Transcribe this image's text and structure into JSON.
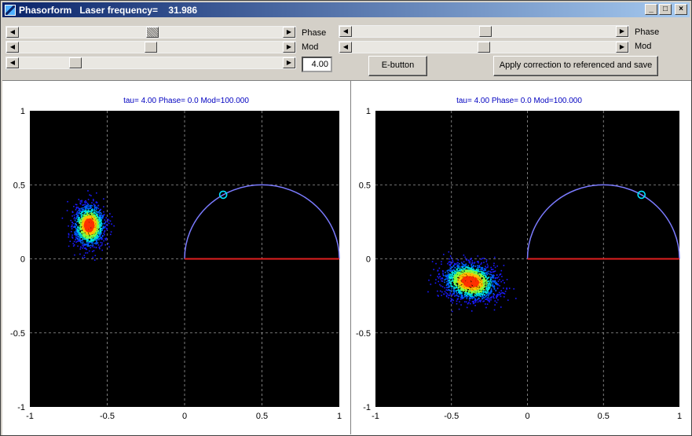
{
  "window": {
    "title": "Phasorform   Laser frequency=    31.986",
    "min_label": "_",
    "max_label": "□",
    "close_label": "×"
  },
  "controls": {
    "left": {
      "phase_label": "Phase",
      "mod_label": "Mod",
      "tau_value": "4.00"
    },
    "right": {
      "phase_label": "Phase",
      "mod_label": "Mod"
    },
    "e_button_label": "E-button",
    "apply_button_label": "Apply correction to referenced and save"
  },
  "plots": [
    {
      "title": "tau= 4.00 Phase=  0.0 Mod=100.000",
      "x_ticks": [
        "-1",
        "-0.5",
        "0",
        "0.5",
        "1"
      ],
      "y_ticks": [
        "1",
        "0.5",
        "0",
        "-0.5",
        "-1"
      ]
    },
    {
      "title": "tau= 4.00 Phase=  0.0 Mod=100.000",
      "x_ticks": [
        "-1",
        "-0.5",
        "0",
        "0.5",
        "1"
      ],
      "y_ticks": [
        "1",
        "0.5",
        "0",
        "-0.5",
        "-1"
      ]
    }
  ],
  "colors": {
    "title_text": "#0000c0",
    "semicircle": "#7b7bff",
    "baseline": "#e02020",
    "marker": "#00e0ff",
    "plot_bg": "#000000",
    "grid": "#9a9a9a"
  }
}
